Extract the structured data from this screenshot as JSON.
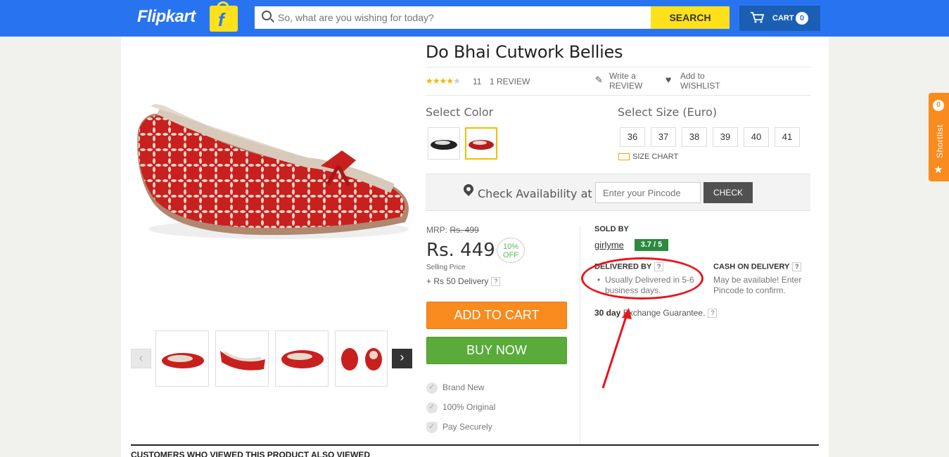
{
  "header": {
    "logo_text": "Flipkart",
    "search_placeholder": "So, what are you wishing for today?",
    "search_button": "SEARCH",
    "cart_label": "CART",
    "cart_count": "0",
    "brand_color": "#2874f0"
  },
  "product": {
    "title": "Do Bhai Cutwork Bellies",
    "rating_stars": 3.5,
    "rating_count": "11",
    "review_link": "1 REVIEW",
    "write_review": "Write a REVIEW",
    "add_wishlist": "Add to WISHLIST",
    "select_color_label": "Select Color",
    "colors": [
      "black",
      "red"
    ],
    "select_size_label": "Select Size  (Euro)",
    "sizes": [
      "36",
      "37",
      "38",
      "39",
      "40",
      "41"
    ],
    "size_chart_label": "SIZE CHART"
  },
  "availability": {
    "label": "Check Availability at",
    "pincode_placeholder": "Enter your Pincode",
    "check_button": "CHECK"
  },
  "pricing": {
    "mrp_label": "MRP:",
    "mrp_value": "Rs. 499",
    "price": "Rs. 449",
    "discount_pct": "10%",
    "discount_off": "OFF",
    "selling_price_label": "Selling Price",
    "delivery_fee": "+ Rs 50 Delivery",
    "qmark": "?"
  },
  "actions": {
    "add_to_cart": "ADD TO CART",
    "buy_now": "BUY NOW",
    "add_to_cart_color": "#f98b1f",
    "buy_now_color": "#5aab3a"
  },
  "features": [
    "Brand New",
    "100% Original",
    "Pay Securely"
  ],
  "seller": {
    "sold_by_label": "SOLD BY",
    "name": "girlyme",
    "rating": "3.7 / 5",
    "delivered_by_label": "DELIVERED BY",
    "delivered_text": "Usually Delivered in 5-6 business days.",
    "cod_label": "CASH ON DELIVERY",
    "cod_text": "May be available! Enter Pincode to confirm.",
    "exchange_bold": "30 day",
    "exchange_text": " Exchange Guarantee."
  },
  "gallery": {
    "prev": "‹",
    "next": "›"
  },
  "bottom": {
    "section_title": "CUSTOMERS WHO VIEWED THIS PRODUCT ALSO VIEWED"
  },
  "shortlist": {
    "label": "Shortlist",
    "count": "0"
  }
}
